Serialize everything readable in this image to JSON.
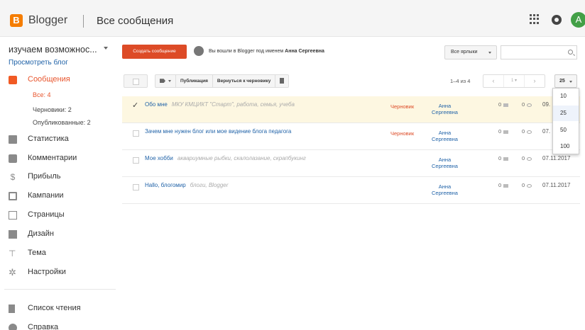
{
  "header": {
    "logo_letter": "B",
    "brand": "Blogger",
    "title": "Все сообщения",
    "avatar_letter": "A"
  },
  "sidebar": {
    "blog_name": "изучаем возможнос...",
    "view_blog": "Просмотреть блог",
    "posts": "Сообщения",
    "sub": {
      "all": "Все: 4",
      "drafts": "Черновики: 2",
      "published": "Опубликованные: 2"
    },
    "stats": "Статистика",
    "comments": "Комментарии",
    "earnings": "Прибыль",
    "campaigns": "Кампании",
    "pages": "Страницы",
    "layout": "Дизайн",
    "theme": "Тема",
    "settings": "Настройки",
    "reading_list": "Список чтения",
    "help": "Справка"
  },
  "topbar": {
    "create_label": "Создать сообщение",
    "signed_in_prefix": "Вы вошли в Blogger под именем",
    "signed_in_user": "Анна Сергеевна",
    "labels_filter": "Все ярлыки",
    "search_placeholder": ""
  },
  "toolbar": {
    "publish": "Публикация",
    "revert": "Вернуться к черновику",
    "range": "1–4 из 4",
    "page_current": "1",
    "per_page": "25"
  },
  "posts": [
    {
      "title": "Обо мне",
      "labels": "МКУ КМЦИКТ \"Старт\", работа, семья, учеба",
      "status": "Черновик",
      "author_line1": "Анна",
      "author_line2": "Сергеевна",
      "comments": "0",
      "views": "0",
      "date": "09."
    },
    {
      "title": "Зачем мне нужен блог или мое видение блога педагога",
      "labels": "",
      "status": "Черновик",
      "author_line1": "Анна",
      "author_line2": "Сергеевна",
      "comments": "0",
      "views": "0",
      "date": "07."
    },
    {
      "title": "Мое хобби",
      "labels": "аквариумные рыбки, скалолазание, скрапбукинг",
      "status": "",
      "author_line1": "Анна",
      "author_line2": "Сергеевна",
      "comments": "0",
      "views": "0",
      "date": "07.11.2017"
    },
    {
      "title": "Hallo, блогомир",
      "labels": "блоги, Blogger",
      "status": "",
      "author_line1": "Анна",
      "author_line2": "Сергеевна",
      "comments": "0",
      "views": "0",
      "date": "07.11.2017"
    }
  ],
  "per_page_options": [
    "10",
    "25",
    "50",
    "100"
  ],
  "colors": {
    "brand_orange": "#f57d00",
    "create_red": "#dd4b27",
    "link_blue": "#2163a8",
    "selected_row": "#fdf7e1"
  }
}
